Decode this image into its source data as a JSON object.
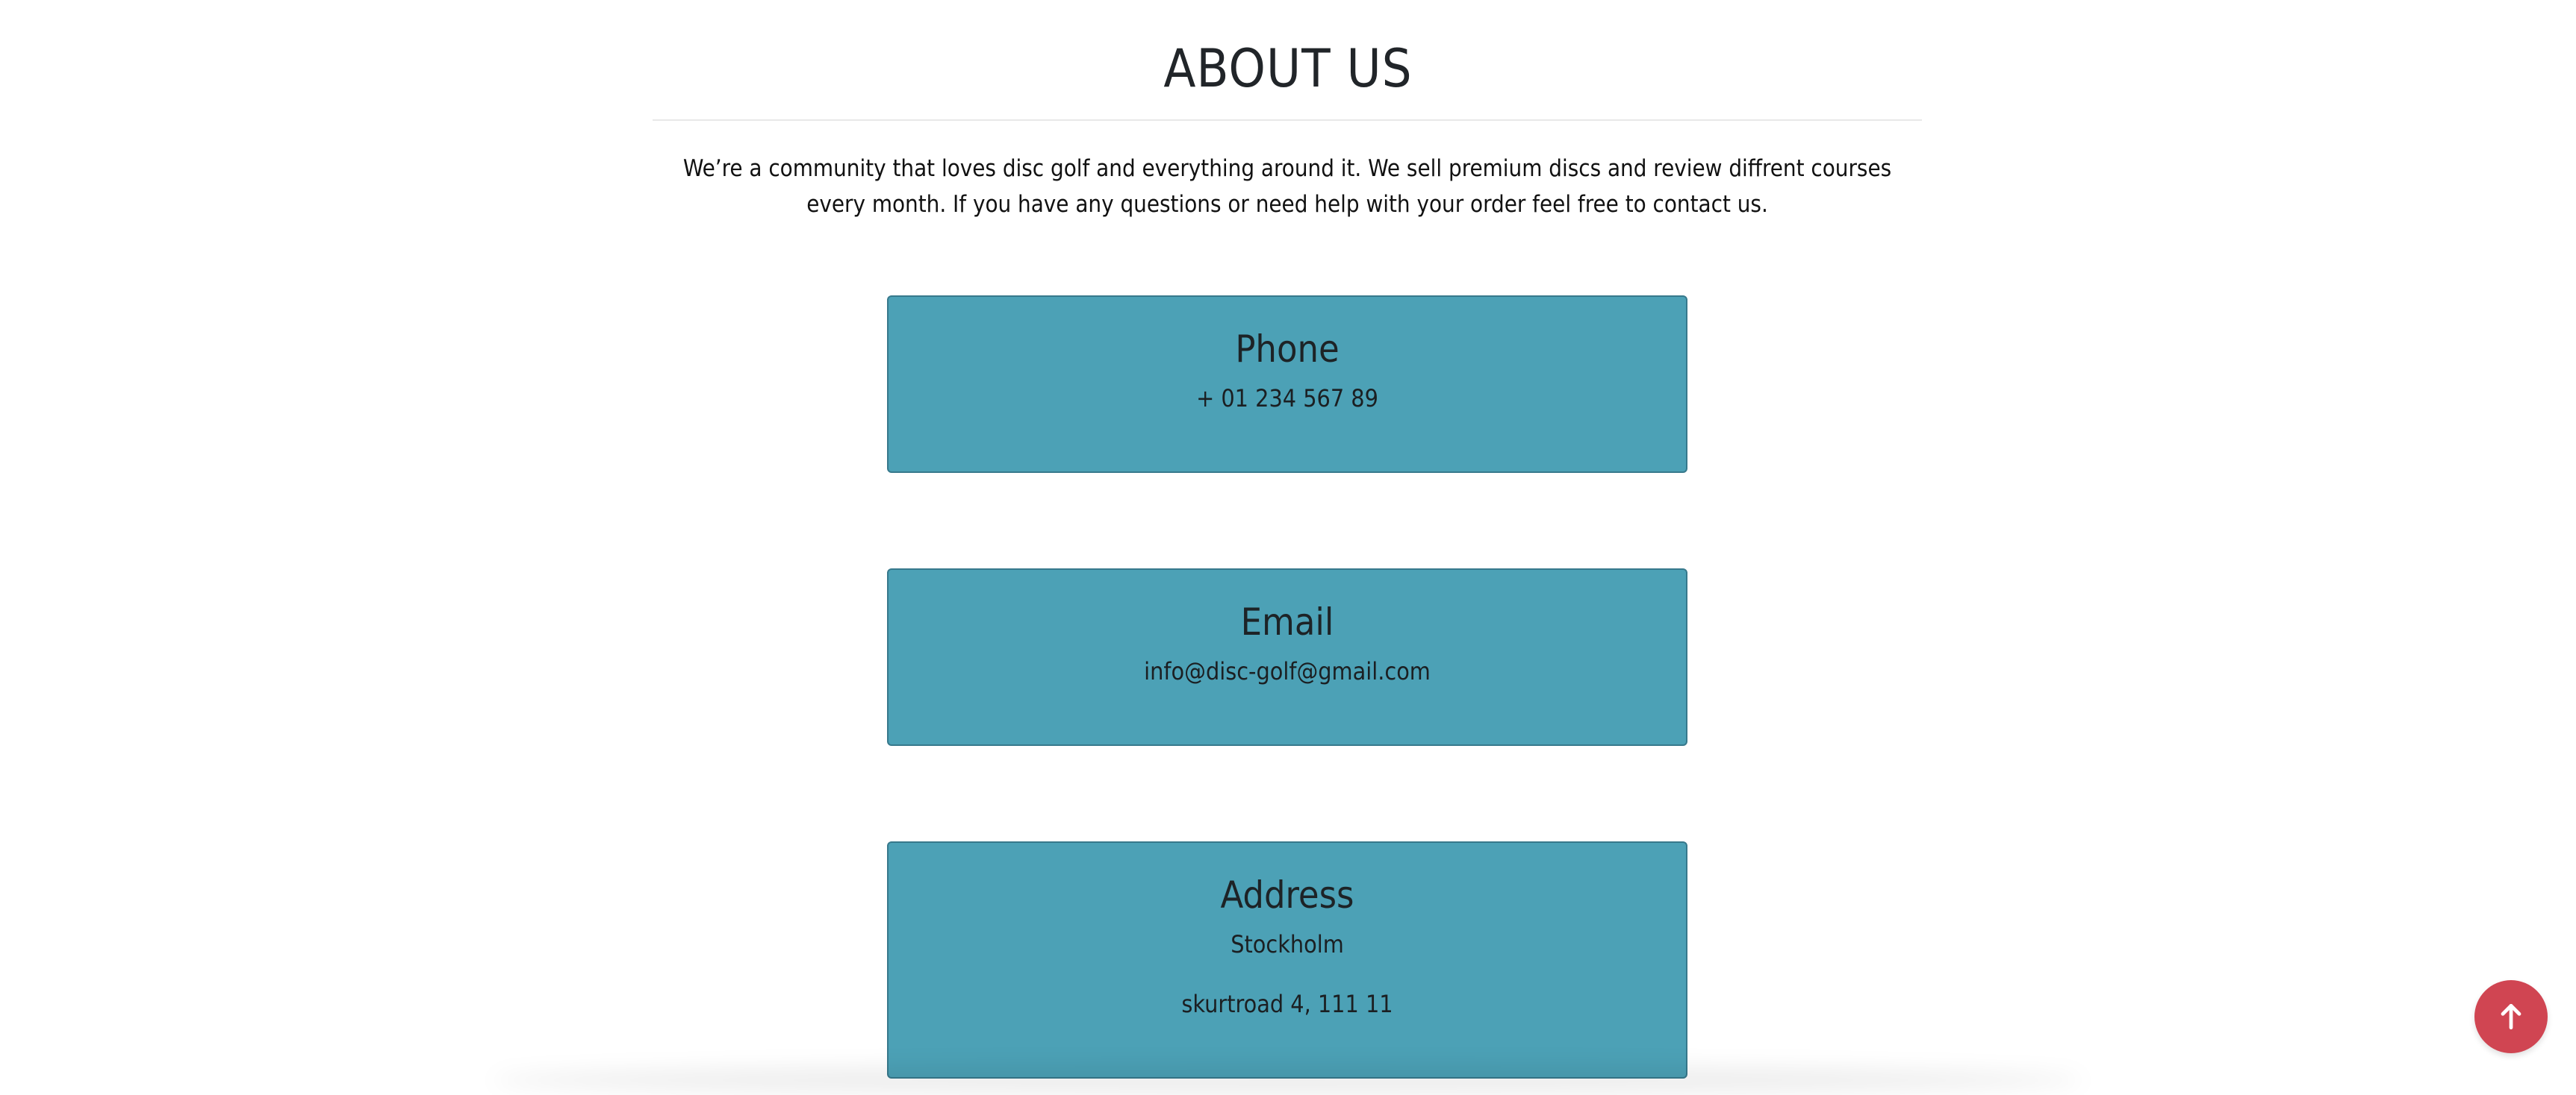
{
  "page": {
    "title": "ABOUT US",
    "intro": "We’re a community that loves disc golf and everything around it. We sell premium discs and review diffrent courses every month. If you have any questions or need help with your order feel free to contact us."
  },
  "contact": {
    "phone": {
      "heading": "Phone",
      "value": "+ 01 234 567 89"
    },
    "email": {
      "heading": "Email",
      "value": "info@disc-golf@gmail.com"
    },
    "address": {
      "heading": "Address",
      "city": "Stockholm",
      "street": "skurtroad 4, 111 11"
    }
  },
  "scroll_top": {
    "icon": "arrow-up-icon"
  },
  "colors": {
    "card_background": "#4ca1b6",
    "card_border": "#37798c",
    "scroll_button": "#d04552"
  }
}
